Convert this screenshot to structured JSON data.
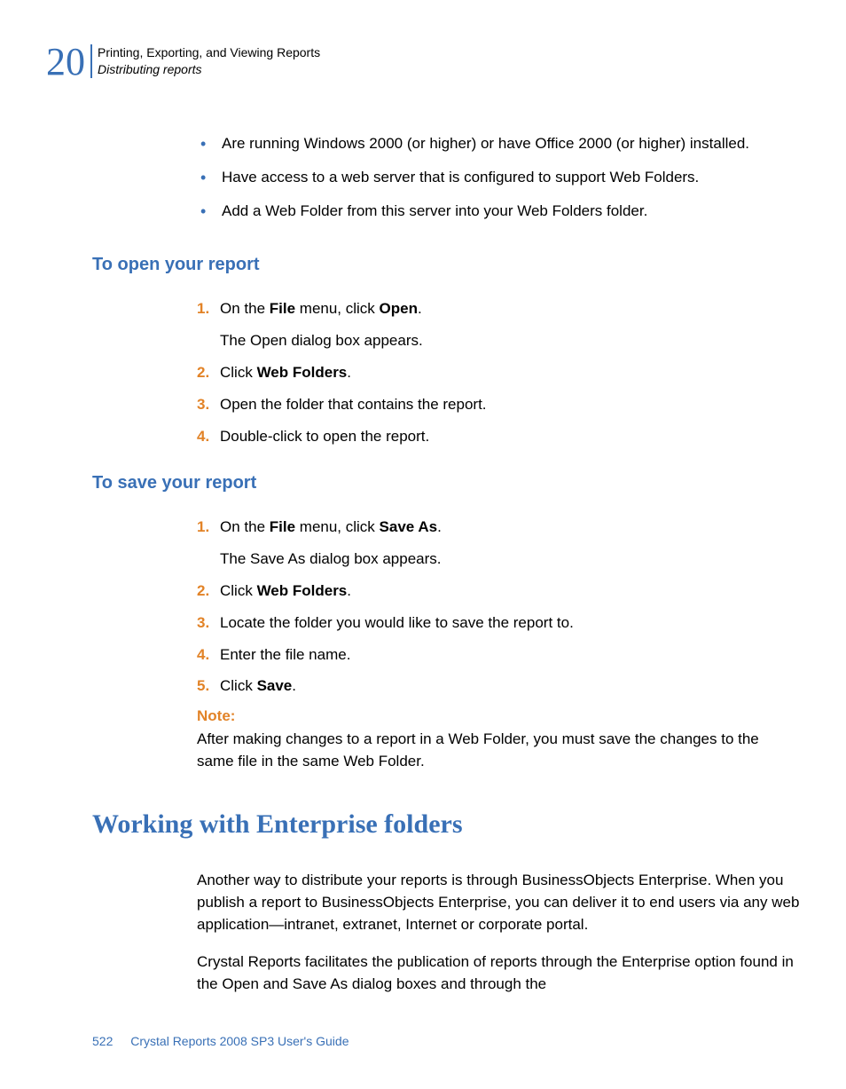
{
  "header": {
    "chapter_number": "20",
    "title": "Printing, Exporting, and Viewing Reports",
    "subtitle": "Distributing reports"
  },
  "intro_bullets": [
    "Are running Windows 2000 (or higher) or have Office 2000 (or higher) installed.",
    "Have access to a web server that is configured to support Web Folders.",
    "Add a Web Folder from this server into your Web Folders folder."
  ],
  "section_open": {
    "heading": "To open your report",
    "steps": {
      "s1_pre": "On the ",
      "s1_bold1": "File",
      "s1_mid": " menu, click ",
      "s1_bold2": "Open",
      "s1_post": ".",
      "s1_sub": "The Open dialog box appears.",
      "s2_pre": "Click ",
      "s2_bold": "Web Folders",
      "s2_post": ".",
      "s3": "Open the folder that contains the report.",
      "s4": "Double-click to open the report."
    }
  },
  "section_save": {
    "heading": "To save your report",
    "steps": {
      "s1_pre": "On the ",
      "s1_bold1": "File",
      "s1_mid": " menu, click ",
      "s1_bold2": "Save As",
      "s1_post": ".",
      "s1_sub": "The Save As dialog box appears.",
      "s2_pre": "Click ",
      "s2_bold": "Web Folders",
      "s2_post": ".",
      "s3": "Locate the folder you would like to save the report to.",
      "s4": "Enter the file name.",
      "s5_pre": "Click ",
      "s5_bold": "Save",
      "s5_post": "."
    },
    "note_label": "Note:",
    "note_body": "After making changes to a report in a Web Folder, you must save the changes to the same file in the same Web Folder."
  },
  "section_enterprise": {
    "heading": "Working with Enterprise folders",
    "para1": "Another way to distribute your reports is through BusinessObjects Enterprise. When you publish a report to BusinessObjects Enterprise, you can deliver it to end users via any web application—intranet, extranet, Internet or corporate portal.",
    "para2": "Crystal Reports facilitates the publication of reports through the Enterprise option found in the Open and Save As dialog boxes and through the"
  },
  "footer": {
    "page_number": "522",
    "doc_title": "Crystal Reports 2008 SP3 User's Guide"
  },
  "numbers": {
    "n1": "1.",
    "n2": "2.",
    "n3": "3.",
    "n4": "4.",
    "n5": "5."
  }
}
